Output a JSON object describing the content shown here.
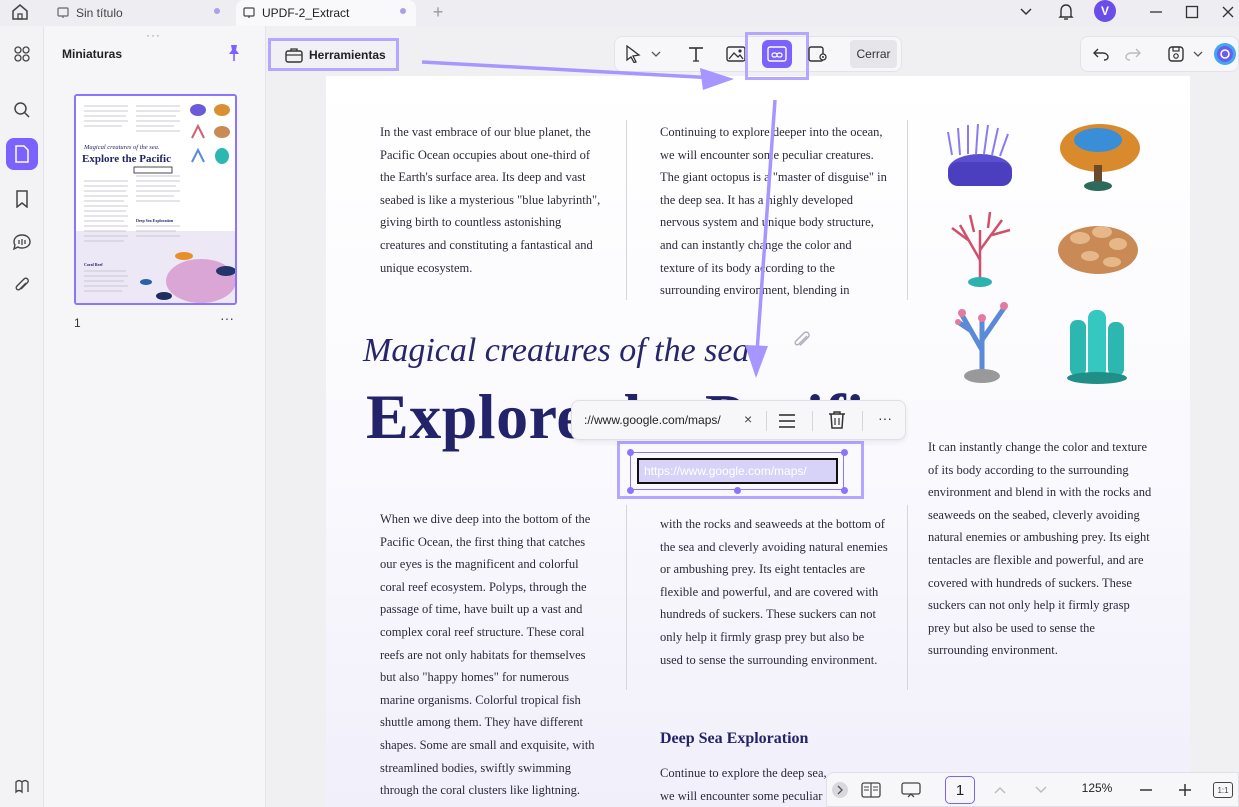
{
  "tabs": [
    {
      "label": "Sin título"
    },
    {
      "label": "UPDF-2_Extract"
    }
  ],
  "user": {
    "initial": "V"
  },
  "thumbnails": {
    "title": "Miniaturas",
    "page_number": "1",
    "more": "···",
    "preview_title_small": "Magical creatures of the sea.",
    "preview_title_big": "Explore the Pacific",
    "preview_coral": "Coral Reef",
    "preview_deep": "Deep Sea Exploration"
  },
  "tools_button": {
    "label": "Herramientas"
  },
  "toolbar": {
    "close_label": "Cerrar"
  },
  "document": {
    "col1_top": "In the vast embrace of our blue planet, the Pacific Ocean occupies about one-third of the Earth's surface area. Its deep and vast seabed is like a mysterious \"blue labyrinth\", giving birth to countless astonishing creatures and constituting a fantastical and unique ecosystem.",
    "col2_top": "Continuing to explore deeper into the ocean, we will encounter some peculiar creatures. The giant octopus is a \"master of disguise\" in the deep sea. It has a highly developed nervous system and unique body structure, and can instantly change the color and texture of its body according to the surrounding environment, blending in",
    "subtitle": "Magical creatures of the sea.",
    "title": "Explore the Pacific",
    "col1_bottom": "When we dive deep into the bottom of the Pacific Ocean, the first thing that catches our eyes is the magnificent and colorful coral reef ecosystem. Polyps, through the passage of time, have built up a vast and complex coral reef structure. These coral reefs are not only habitats for themselves but also \"happy homes\" for numerous marine organisms. Colorful tropical fish shuttle among them. They have different shapes. Some are small and exquisite, with streamlined bodies, swiftly swimming through the coral clusters like lightning.",
    "col2_bottom": "with the rocks and seaweeds at the bottom of the sea and cleverly avoiding natural enemies or ambushing prey. Its eight tentacles are flexible and powerful, and are covered with hundreds of suckers. These suckers can not only help it firmly grasp prey but also be used to sense the surrounding environment.",
    "col3_bottom": "It can instantly change the color and texture of its body according to the surrounding environment and blend in with the rocks and seaweeds on the seabed, cleverly avoiding natural enemies or ambushing prey. Its eight tentacles are flexible and powerful, and are covered with hundreds of suckers. These suckers can not only help it firmly grasp prey but also be used to sense the surrounding environment.",
    "deep_heading": "Deep Sea Exploration",
    "col2_end": "Continue to explore the deep sea, we will encounter some peculiar cre"
  },
  "link_popup": {
    "url": "://www.google.com/maps/",
    "close": "×",
    "more": "···"
  },
  "link_box": {
    "text": "https://www.google.com/maps/"
  },
  "bottom_bar": {
    "page": "1",
    "zoom": "125%",
    "fit": "1:1"
  },
  "colors": {
    "accent": "#7b61ff",
    "highlight": "#b5a7ff",
    "title": "#23236a"
  }
}
